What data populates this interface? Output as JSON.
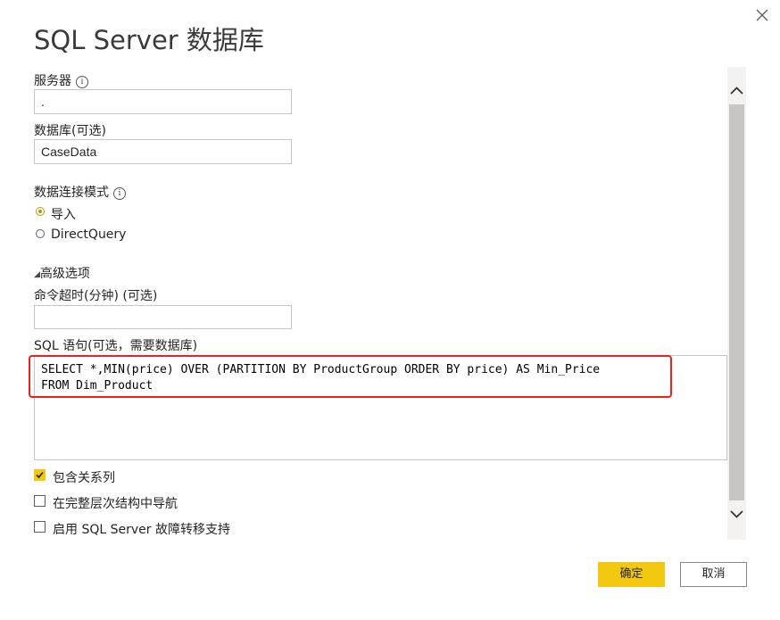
{
  "dialog": {
    "title": "SQL Server 数据库",
    "close_icon": "close-icon"
  },
  "server": {
    "label": "服务器",
    "info_icon": "i",
    "value": "."
  },
  "database": {
    "label": "数据库(可选)",
    "value": "CaseData"
  },
  "connectivity": {
    "label": "数据连接模式",
    "info_icon": "i",
    "options": [
      {
        "label": "导入",
        "selected": true
      },
      {
        "label": "DirectQuery",
        "selected": false
      }
    ]
  },
  "advanced": {
    "toggle_glyph": "◢",
    "label": "高级选项",
    "timeout_label": "命令超时(分钟) (可选)",
    "timeout_value": "",
    "sql_label": "SQL 语句(可选，需要数据库)",
    "sql_lines": [
      "SELECT *,MIN(price) OVER (PARTITION BY ProductGroup ORDER BY price) AS Min_Price",
      "FROM Dim_Product"
    ],
    "checkboxes": [
      {
        "label": "包含关系列",
        "checked": true
      },
      {
        "label": "在完整层次结构中导航",
        "checked": false
      },
      {
        "label": "启用 SQL Server 故障转移支持",
        "checked": false
      }
    ]
  },
  "footer": {
    "ok_label": "确定",
    "cancel_label": "取消"
  },
  "colors": {
    "accent": "#f2c811",
    "highlight_border": "#e8231f"
  }
}
